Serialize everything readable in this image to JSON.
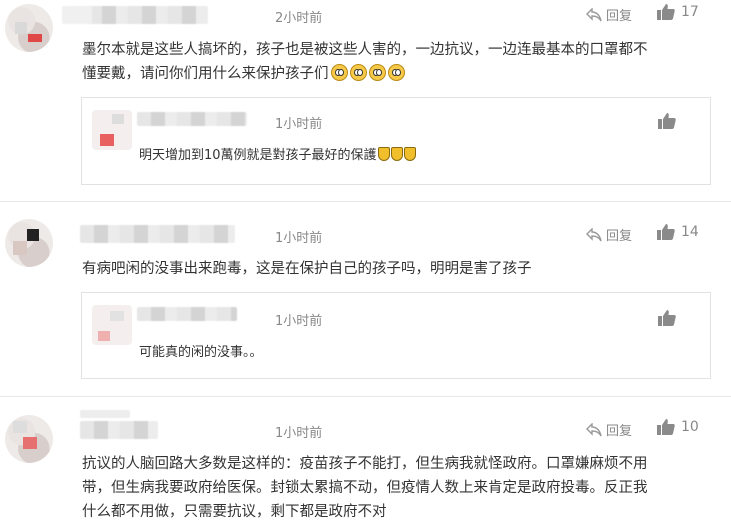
{
  "comments": [
    {
      "time": "2小时前",
      "reply_label": "回复",
      "likes": "17",
      "text_lines": [
        "墨尔本就是这些人搞坏的，孩子也是被这些人害的，一边抗议，一边连最基本的口罩都不",
        "懂要戴，请问你们用什么来保护孩子们"
      ],
      "emoji_count": 4,
      "reply": {
        "time": "1小时前",
        "text": "明天增加到10萬例就是對孩子最好的保護",
        "emoji_count": 3
      }
    },
    {
      "time": "1小时前",
      "reply_label": "回复",
      "likes": "14",
      "text_lines": [
        "有病吧闲的没事出来跑毒，这是在保护自己的孩子吗，明明是害了孩子"
      ],
      "reply": {
        "time": "1小时前",
        "text": "可能真的闲的没事。。"
      }
    },
    {
      "time": "1小时前",
      "reply_label": "回复",
      "likes": "10",
      "text_lines": [
        "抗议的人脑回路大多数是这样的：疫苗孩子不能打，但生病我就怪政府。口罩嫌麻烦不用",
        "带，但生病我要政府给医保。封锁太累搞不动，但疫情人数上来肯定是政府投毒。反正我",
        "什么都不用做，只需要抗议，剩下都是政府不对"
      ]
    }
  ],
  "icons": {
    "reply": "reply-arrow-icon",
    "like": "thumbs-up-icon",
    "emoji": "rolling-eyes-emoji-icon",
    "shield": "shield-emoji-icon"
  },
  "colors": {
    "text": "#333333",
    "meta": "#888888",
    "border": "#e2e2e2",
    "like_icon": "#8a8a8a"
  }
}
